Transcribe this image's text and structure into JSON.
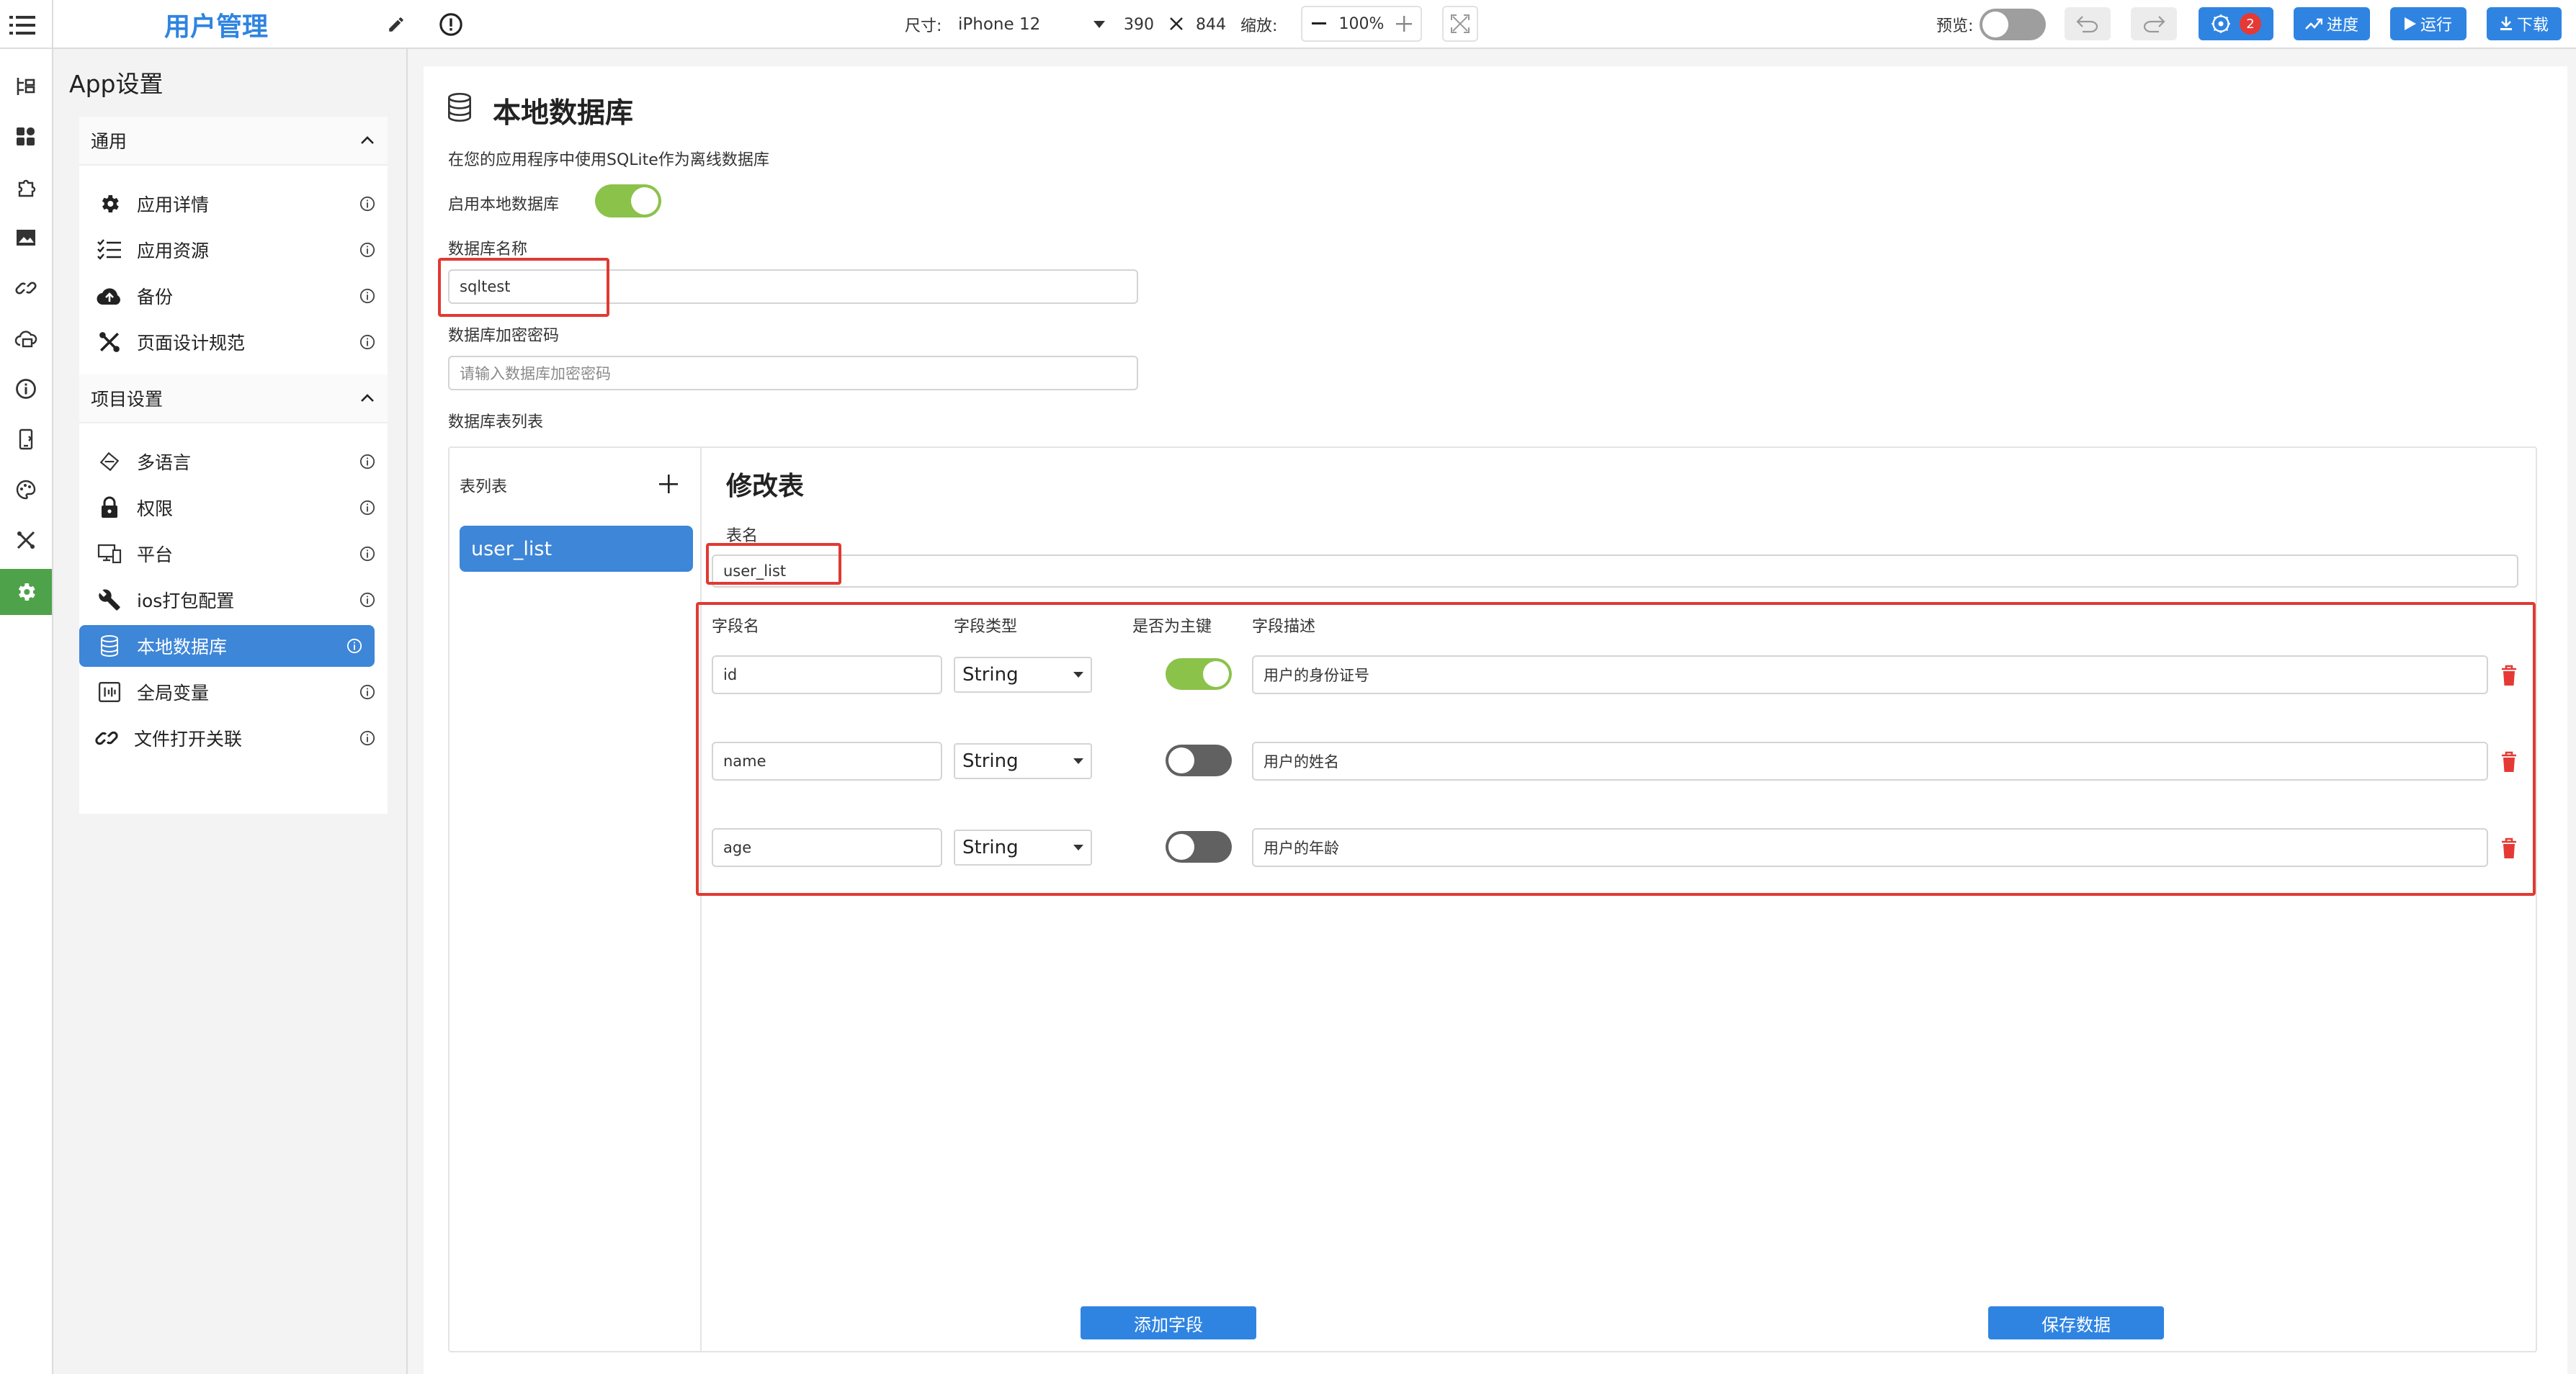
{
  "header": {
    "app_title": "用户管理",
    "size_label": "尺寸:",
    "device": "iPhone 12",
    "width": "390",
    "height": "844",
    "zoom_label": "缩放:",
    "zoom_value": "100%",
    "preview_label": "预览:",
    "debug_badge": "2",
    "progress_label": "进度",
    "run_label": "运行",
    "download_label": "下载"
  },
  "rail": {
    "items": [
      "outline-icon",
      "components-icon",
      "plugin-icon",
      "image-icon",
      "link-icon",
      "cloud-icon",
      "info-icon",
      "mobile-icon",
      "palette-icon",
      "tools-icon",
      "settings-icon"
    ],
    "active_index": 10
  },
  "sidebar": {
    "title": "App设置",
    "general": {
      "title": "通用",
      "items": [
        {
          "label": "应用详情",
          "icon": "gear-icon"
        },
        {
          "label": "应用资源",
          "icon": "checklist-icon"
        },
        {
          "label": "备份",
          "icon": "cloud-upload-icon"
        },
        {
          "label": "页面设计规范",
          "icon": "design-tools-icon"
        }
      ]
    },
    "project": {
      "title": "项目设置",
      "items": [
        {
          "label": "多语言",
          "icon": "language-icon"
        },
        {
          "label": "权限",
          "icon": "lock-icon"
        },
        {
          "label": "平台",
          "icon": "devices-icon"
        },
        {
          "label": "ios打包配置",
          "icon": "wrench-icon"
        },
        {
          "label": "本地数据库",
          "icon": "database-icon"
        },
        {
          "label": "全局变量",
          "icon": "variable-icon"
        },
        {
          "label": "文件打开关联",
          "icon": "link-icon"
        }
      ]
    },
    "selected_item": "本地数据库"
  },
  "main": {
    "title": "本地数据库",
    "description": "在您的应用程序中使用SQLite作为离线数据库",
    "enable_label": "启用本地数据库",
    "enable_on": true,
    "db_name_label": "数据库名称",
    "db_name_value": "sqltest",
    "db_password_label": "数据库加密密码",
    "db_password_placeholder": "请输入数据库加密密码",
    "table_list_label": "数据库表列表",
    "table_list_head": "表列表",
    "tables": [
      "user_list"
    ],
    "edit_title": "修改表",
    "table_name_label": "表名",
    "table_name_value": "user_list",
    "columns": {
      "name": "字段名",
      "type": "字段类型",
      "primary": "是否为主键",
      "desc": "字段描述"
    },
    "fields": [
      {
        "name": "id",
        "type": "String",
        "primary": true,
        "desc": "用户的身份证号"
      },
      {
        "name": "name",
        "type": "String",
        "primary": false,
        "desc": "用户的姓名"
      },
      {
        "name": "age",
        "type": "String",
        "primary": false,
        "desc": "用户的年龄"
      }
    ],
    "add_field_label": "添加字段",
    "save_label": "保存数据"
  },
  "colors": {
    "accent": "#2f84e2",
    "selected": "#3d86d8",
    "toggle_on": "#8bc24a",
    "toggle_off": "#616161",
    "rail_active": "#4ea24a",
    "highlight": "#e03a32",
    "danger": "#e53935"
  }
}
